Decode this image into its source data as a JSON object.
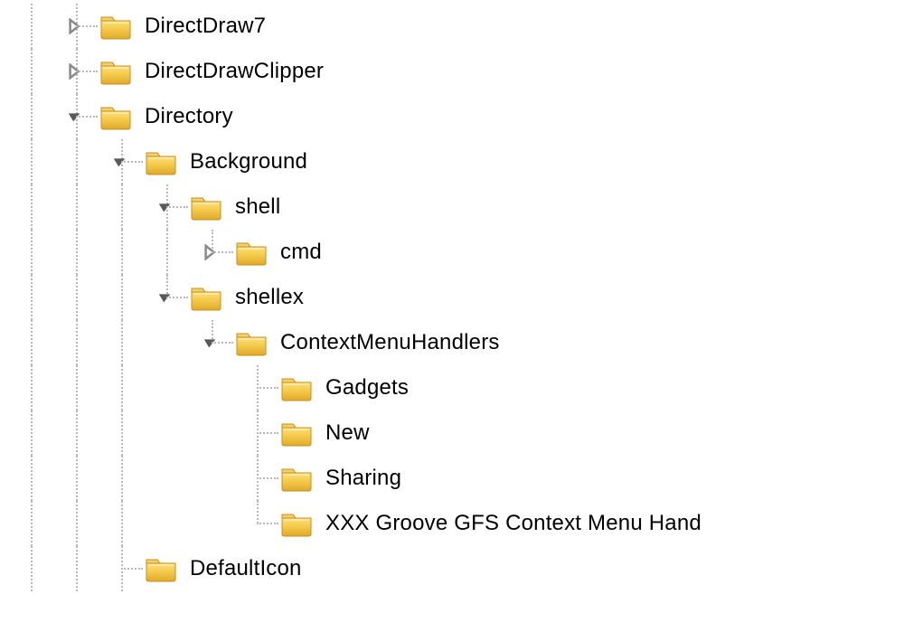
{
  "tree": {
    "root": [
      {
        "id": "directdraw7",
        "label": "DirectDraw7",
        "expanded": false,
        "hasChildren": true
      },
      {
        "id": "directdrawclipper",
        "label": "DirectDrawClipper",
        "expanded": false,
        "hasChildren": true
      },
      {
        "id": "directory",
        "label": "Directory",
        "expanded": true,
        "hasChildren": true,
        "children": [
          {
            "id": "background",
            "label": "Background",
            "expanded": true,
            "hasChildren": true,
            "children": [
              {
                "id": "shell",
                "label": "shell",
                "expanded": true,
                "hasChildren": true,
                "children": [
                  {
                    "id": "cmd",
                    "label": "cmd",
                    "expanded": false,
                    "hasChildren": true
                  }
                ]
              },
              {
                "id": "shellex",
                "label": "shellex",
                "expanded": true,
                "hasChildren": true,
                "children": [
                  {
                    "id": "contextmenuhandlers",
                    "label": "ContextMenuHandlers",
                    "expanded": true,
                    "hasChildren": true,
                    "children": [
                      {
                        "id": "gadgets",
                        "label": "Gadgets",
                        "expanded": false,
                        "hasChildren": false
                      },
                      {
                        "id": "new",
                        "label": "New",
                        "expanded": false,
                        "hasChildren": false
                      },
                      {
                        "id": "sharing",
                        "label": "Sharing",
                        "expanded": false,
                        "hasChildren": false
                      },
                      {
                        "id": "xxx-groove",
                        "label": "XXX Groove GFS Context Menu Hand",
                        "expanded": false,
                        "hasChildren": false
                      }
                    ]
                  }
                ]
              }
            ]
          },
          {
            "id": "defaulticon",
            "label": "DefaultIcon",
            "expanded": false,
            "hasChildren": false
          }
        ]
      }
    ]
  }
}
